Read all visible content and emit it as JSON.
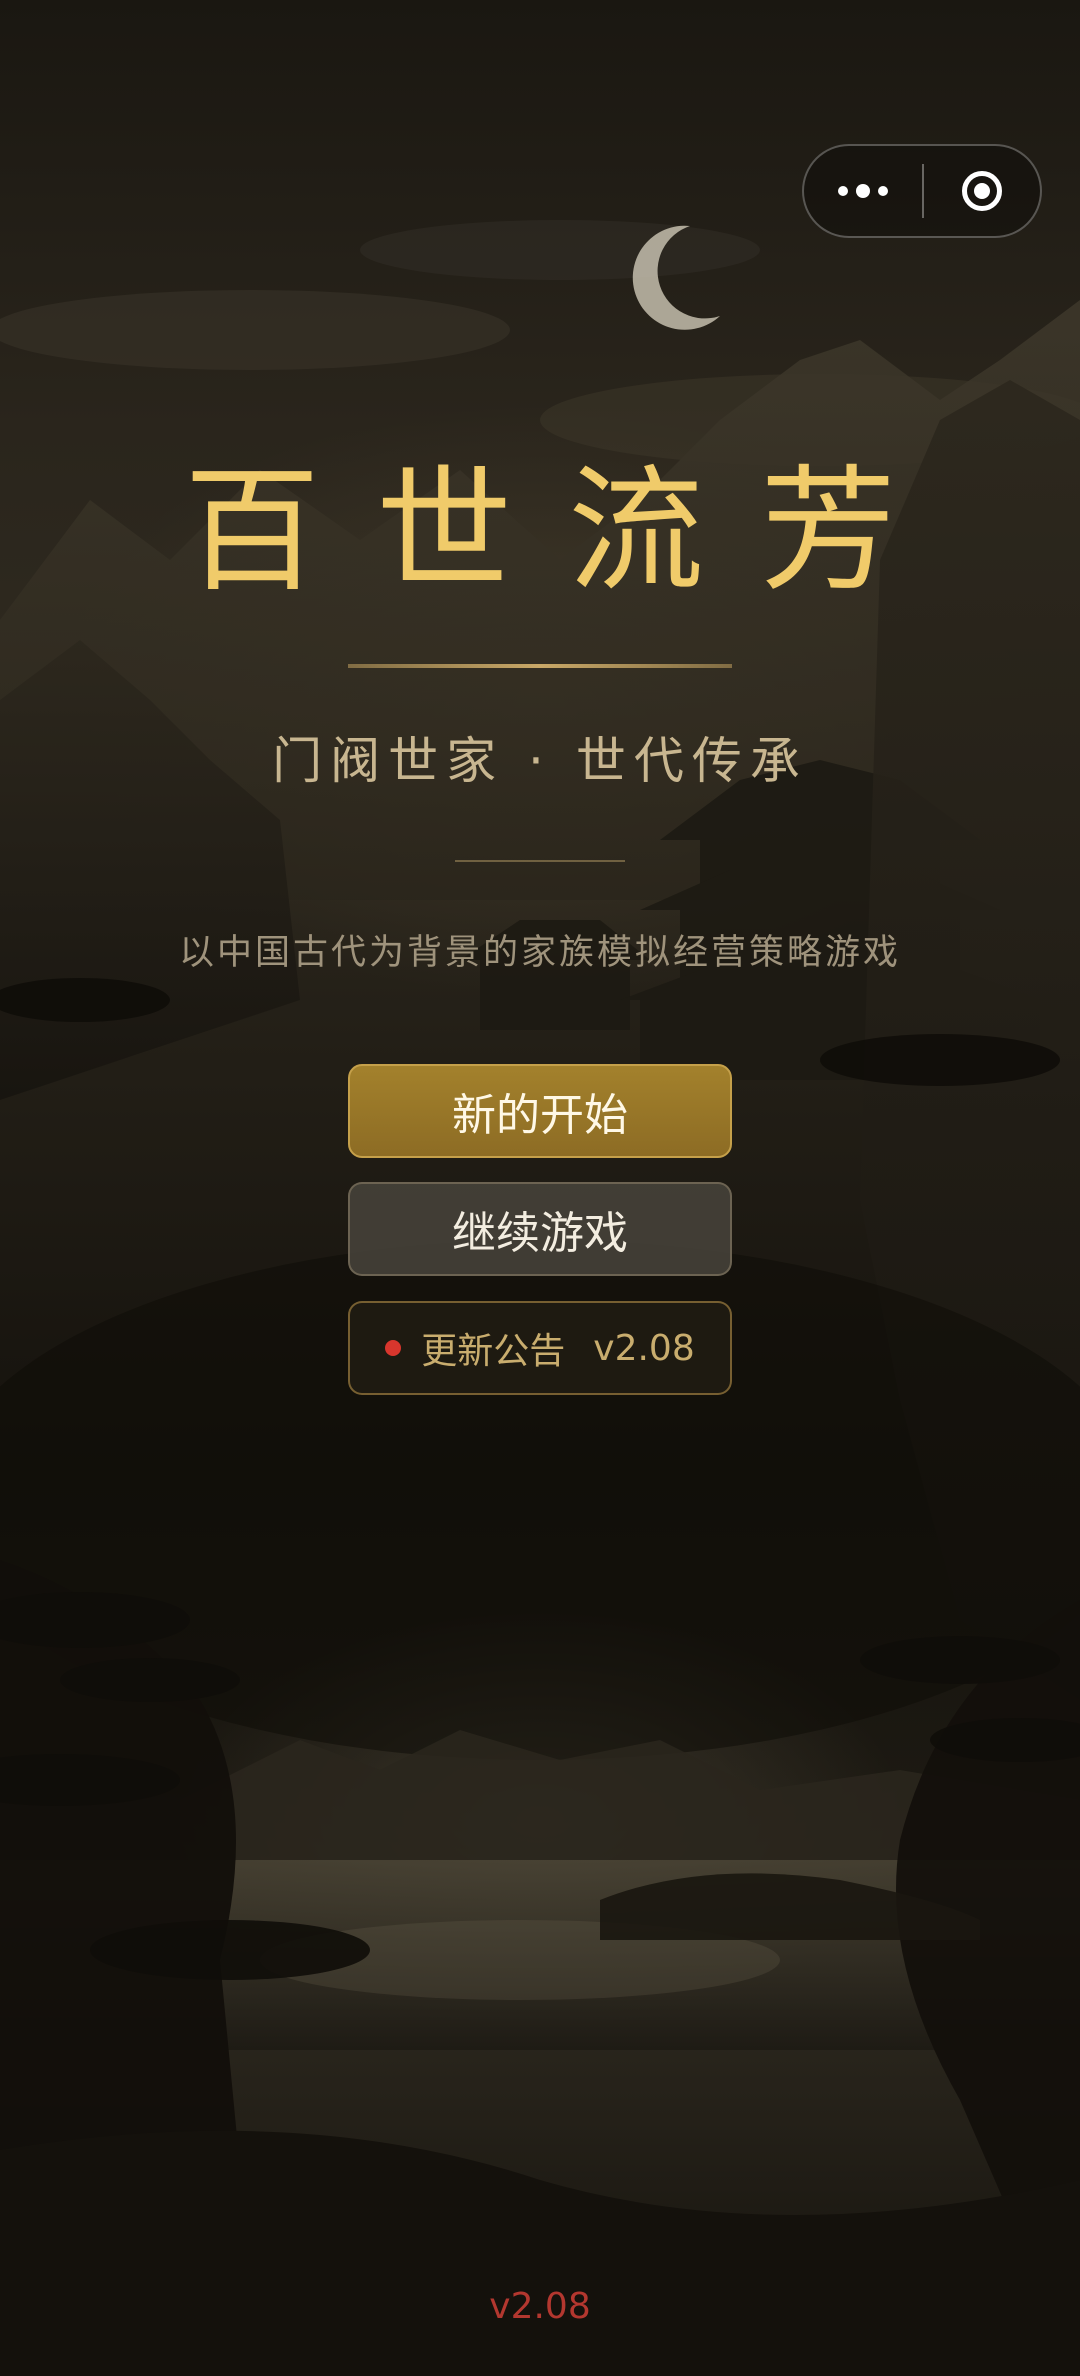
{
  "capsule": {
    "more_icon": "more-dots-icon",
    "close_icon": "target-close-icon"
  },
  "title": "百世流芳",
  "subtitle": "门阀世家 · 世代传承",
  "description": "以中国古代为背景的家族模拟经营策略游戏",
  "buttons": {
    "new_game": "新的开始",
    "continue": "继续游戏",
    "notice_label": "更新公告",
    "notice_version": "v2.08"
  },
  "footer_version": "v2.08",
  "colors": {
    "title": "#f0cb6a",
    "accent_gold": "#a3812c",
    "notice_dot": "#d8362d",
    "footer_version": "#b3372f"
  }
}
